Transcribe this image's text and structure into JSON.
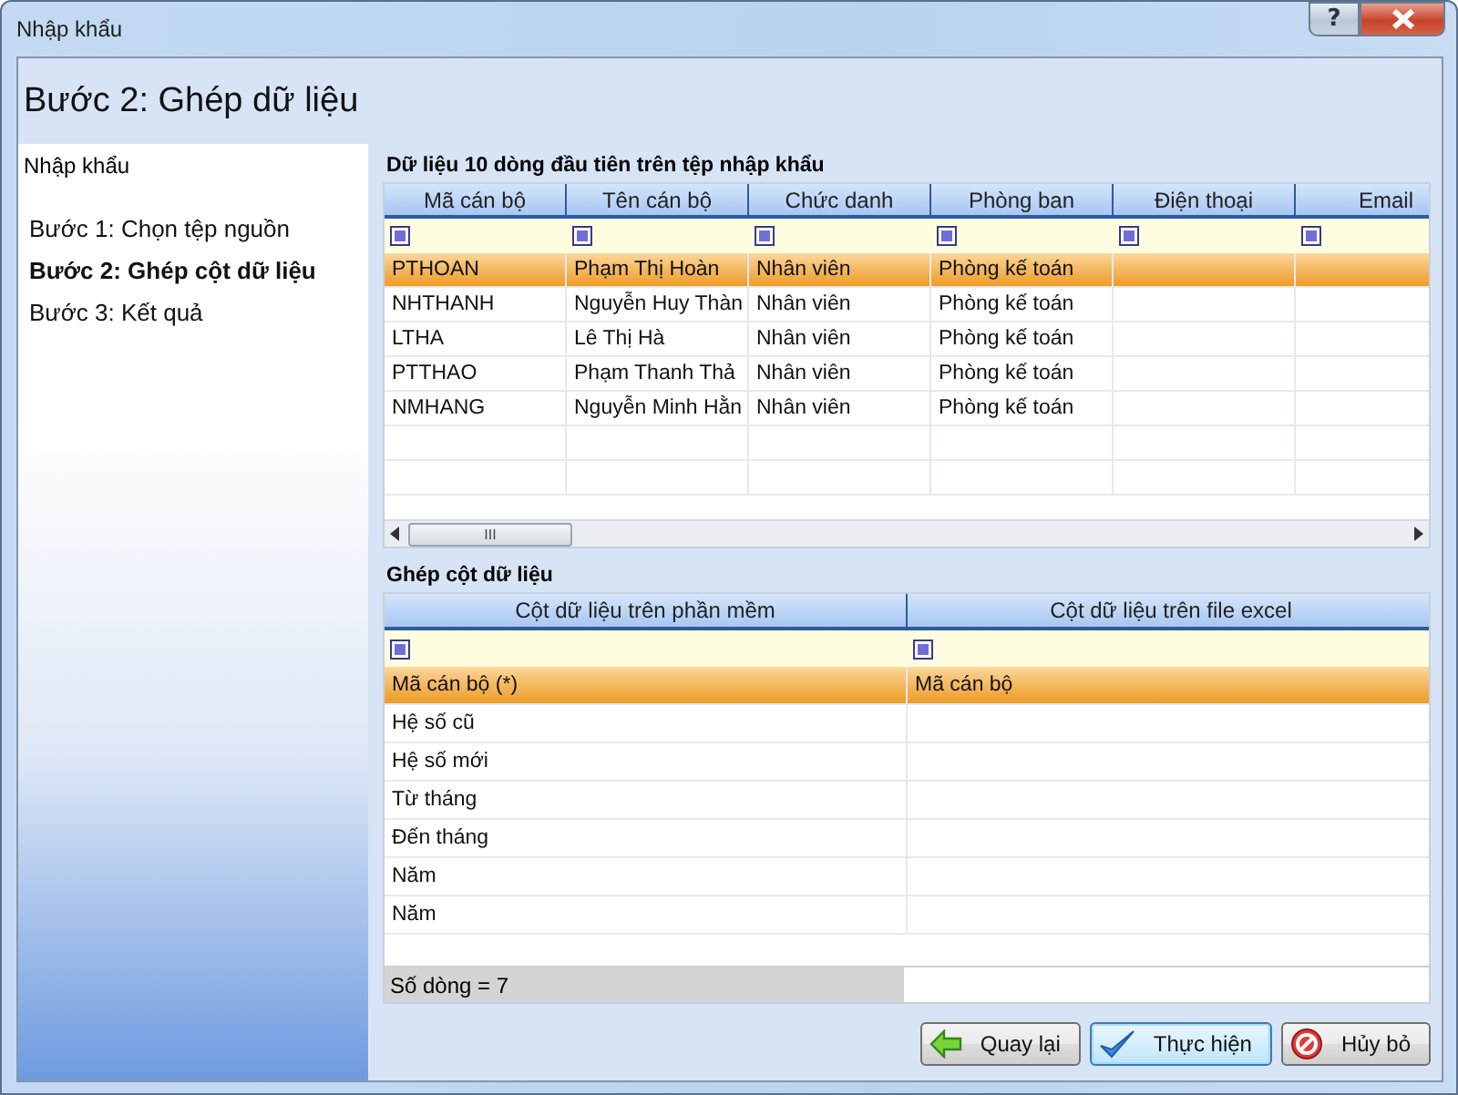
{
  "window": {
    "title": "Nhập khẩu",
    "help_label": "?"
  },
  "heading": "Bước 2: Ghép dữ liệu",
  "sidebar": {
    "title": "Nhập khẩu",
    "items": [
      {
        "label": "Bước 1: Chọn tệp nguồn",
        "selected": false
      },
      {
        "label": "Bước 2: Ghép cột dữ liệu",
        "selected": true
      },
      {
        "label": "Bước 3: Kết quả",
        "selected": false
      }
    ]
  },
  "preview": {
    "title": "Dữ liệu 10 dòng đầu tiên trên tệp nhập khẩu",
    "columns": [
      "Mã cán bộ",
      "Tên cán bộ",
      "Chức danh",
      "Phòng ban",
      "Điện thoại",
      "Email"
    ],
    "rows": [
      {
        "cells": [
          "PTHOAN",
          "Phạm Thị Hoàn",
          "Nhân viên",
          "Phòng kế toán",
          "",
          ""
        ],
        "selected": true
      },
      {
        "cells": [
          "NHTHANH",
          "Nguyễn Huy Thàn",
          "Nhân viên",
          "Phòng kế toán",
          "",
          ""
        ],
        "selected": false
      },
      {
        "cells": [
          "LTHA",
          "Lê Thị Hà",
          "Nhân viên",
          "Phòng kế toán",
          "",
          ""
        ],
        "selected": false
      },
      {
        "cells": [
          "PTTHAO",
          "Phạm Thanh Thả",
          "Nhân viên",
          "Phòng kế toán",
          "",
          ""
        ],
        "selected": false
      },
      {
        "cells": [
          "NMHANG",
          "Nguyễn Minh Hằn",
          "Nhân viên",
          "Phòng kế toán",
          "",
          ""
        ],
        "selected": false
      }
    ],
    "scrollbar_label": "III"
  },
  "mapping": {
    "title": "Ghép cột dữ liệu",
    "columns": [
      "Cột dữ liệu trên phần mềm",
      "Cột dữ liệu trên file excel"
    ],
    "rows": [
      {
        "cells": [
          "Mã cán bộ (*)",
          "Mã cán bộ"
        ],
        "selected": true
      },
      {
        "cells": [
          "Hệ số cũ",
          ""
        ],
        "selected": false
      },
      {
        "cells": [
          "Hệ số mới",
          ""
        ],
        "selected": false
      },
      {
        "cells": [
          "Từ tháng",
          ""
        ],
        "selected": false
      },
      {
        "cells": [
          "Đến tháng",
          ""
        ],
        "selected": false
      },
      {
        "cells": [
          "Năm",
          ""
        ],
        "selected": false
      },
      {
        "cells": [
          "Năm",
          ""
        ],
        "selected": false
      }
    ],
    "footer": "Số dòng = 7"
  },
  "buttons": [
    {
      "kind": "back",
      "label": "Quay lại",
      "focused": false
    },
    {
      "kind": "ok",
      "label": "Thực hiện",
      "focused": true
    },
    {
      "kind": "cancel",
      "label": "Hủy bỏ",
      "focused": false
    }
  ]
}
